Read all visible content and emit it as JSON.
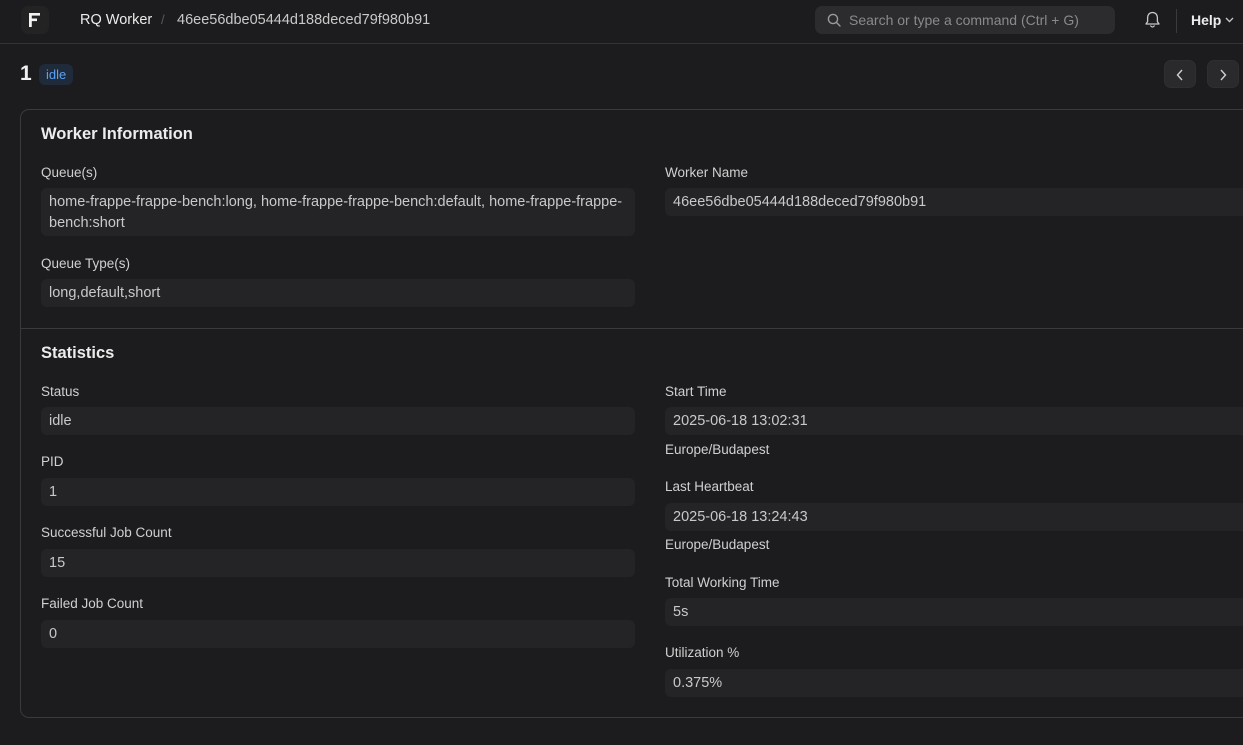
{
  "navbar": {
    "logo_letter": "F",
    "breadcrumbs": [
      "RQ Worker",
      "46ee56dbe05444d188deced79f980b91"
    ],
    "search_placeholder": "Search or type a command (Ctrl + G)",
    "help_label": "Help"
  },
  "page": {
    "title": "1",
    "status_badge": "idle"
  },
  "worker_information": {
    "section_title": "Worker Information",
    "queues_label": "Queue(s)",
    "queues_value": "home-frappe-frappe-bench:long, home-frappe-frappe-bench:default, home-frappe-frappe-bench:short",
    "worker_name_label": "Worker Name",
    "worker_name_value": "46ee56dbe05444d188deced79f980b91",
    "queue_types_label": "Queue Type(s)",
    "queue_types_value": "long,default,short"
  },
  "statistics": {
    "section_title": "Statistics",
    "status_label": "Status",
    "status_value": "idle",
    "pid_label": "PID",
    "pid_value": "1",
    "successful_label": "Successful Job Count",
    "successful_value": "15",
    "failed_label": "Failed Job Count",
    "failed_value": "0",
    "start_time_label": "Start Time",
    "start_time_value": "2025-06-18 13:02:31",
    "start_time_tz": "Europe/Budapest",
    "heartbeat_label": "Last Heartbeat",
    "heartbeat_value": "2025-06-18 13:24:43",
    "heartbeat_tz": "Europe/Budapest",
    "working_time_label": "Total Working Time",
    "working_time_value": "5s",
    "utilization_label": "Utilization %",
    "utilization_value": "0.375%"
  },
  "colors": {
    "background": "#1c1c1e",
    "field_background": "#242426",
    "badge_text": "#5aa2f5",
    "badge_background": "#1f2a3a",
    "border": "#3a3a3a"
  }
}
